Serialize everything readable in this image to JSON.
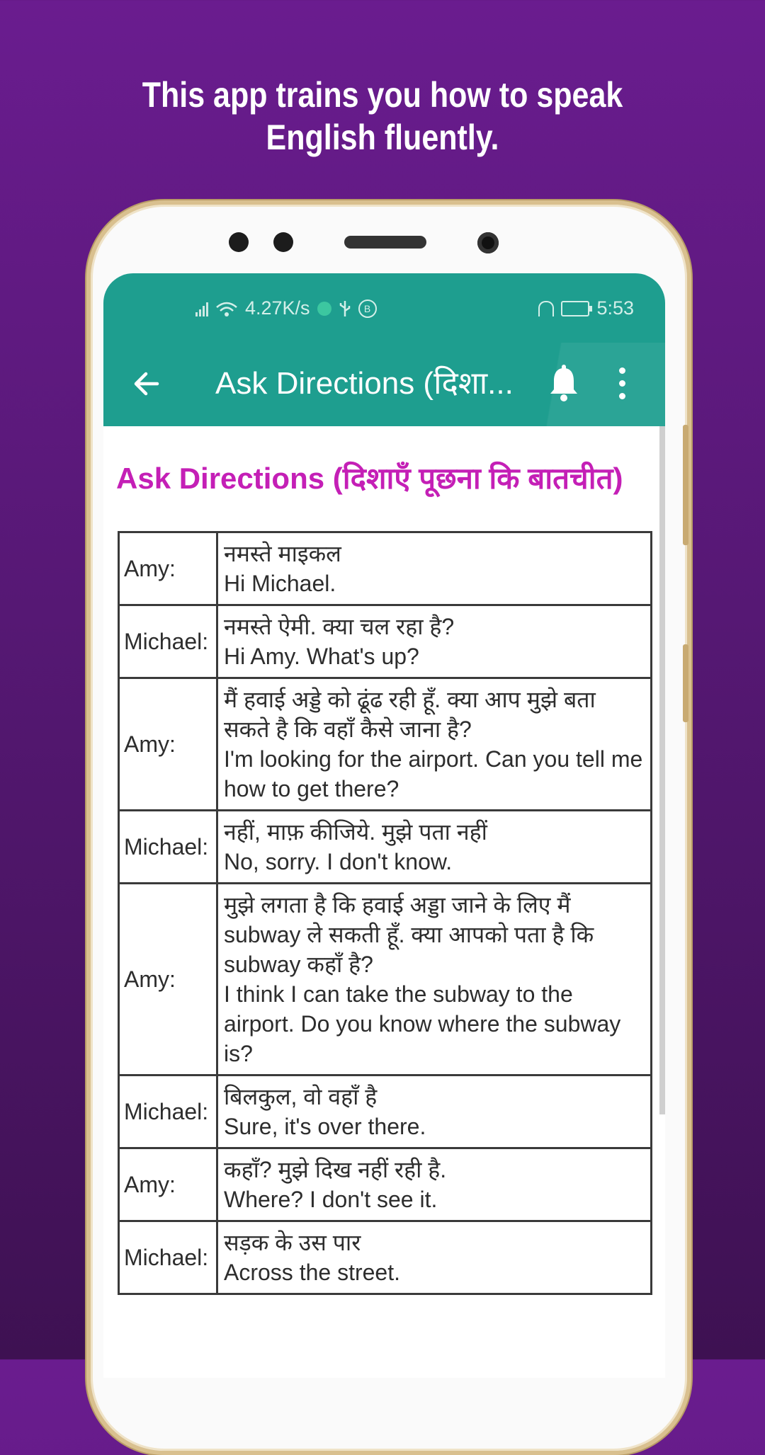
{
  "headline": {
    "line1": "This app trains you how to speak",
    "line2": "English fluently."
  },
  "status_bar": {
    "net_speed": "4.27K/s",
    "time": "5:53"
  },
  "toolbar": {
    "title": "Ask Directions (दिशा...",
    "back_icon": "arrow-left-icon",
    "bell_icon": "bell-icon",
    "menu_icon": "more-vertical-icon"
  },
  "page_title": "Ask Directions (दिशाएँ पूछना कि बातचीत)",
  "dialog": [
    {
      "speaker": "Amy:",
      "hindi": "नमस्ते माइकल",
      "english": "Hi Michael."
    },
    {
      "speaker": "Michael:",
      "hindi": "नमस्ते ऐमी. क्या चल रहा है?",
      "english": "Hi Amy. What's up?"
    },
    {
      "speaker": "Amy:",
      "hindi": "मैं हवाई अड्डे को ढूंढ रही हूँ. क्या आप मुझे बता सकते है कि वहाँ कैसे जाना है?",
      "english": "I'm looking for the airport. Can you tell me how to get there?"
    },
    {
      "speaker": "Michael:",
      "hindi": "नहीं, माफ़ कीजिये. मुझे पता नहीं",
      "english": "No, sorry. I don't know."
    },
    {
      "speaker": "Amy:",
      "hindi": "मुझे लगता है कि हवाई अड्डा जाने के लिए मैं subway ले सकती हूँ. क्या आपको पता है कि subway कहाँ है?",
      "english": "I think I can take the subway to the airport. Do you know where the subway is?"
    },
    {
      "speaker": "Michael:",
      "hindi": "बिलकुल, वो वहाँ है",
      "english": "Sure, it's over there."
    },
    {
      "speaker": "Amy:",
      "hindi": "कहाँ? मुझे दिख नहीं रही है.",
      "english": "Where? I don't see it."
    },
    {
      "speaker": "Michael:",
      "hindi": "सड़क के उस पार",
      "english": "Across the street."
    }
  ],
  "colors": {
    "toolbar": "#1e9e8f",
    "title_accent": "#c41fb6",
    "background": "#5a1a7a"
  }
}
